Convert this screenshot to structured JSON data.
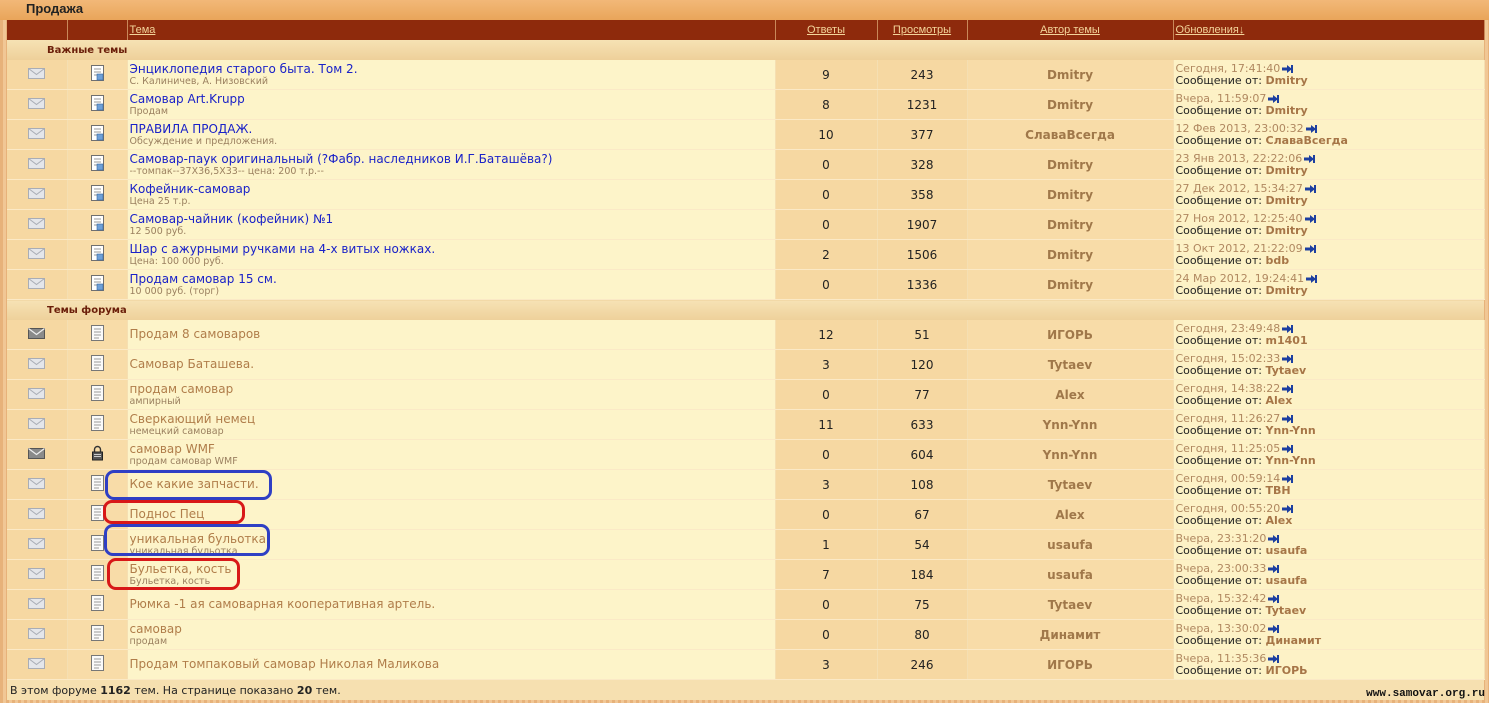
{
  "category": {
    "title": "Продажа"
  },
  "columns": {
    "topic": "Тема",
    "replies": "Ответы",
    "views": "Просмотры",
    "author": "Автор темы",
    "updates": "Обновления↓"
  },
  "sections": {
    "important": "Важные темы",
    "forum": "Темы форума"
  },
  "reply_prefix": "Сообщение от:",
  "important_topics": [
    {
      "title": "Энциклопедия старого быта. Том 2.",
      "desc": "С. Калиничев, А. Низовский",
      "replies": "9",
      "views": "243",
      "author": "Dmitry",
      "date": "Сегодня, 17:41:40",
      "by": "Dmitry"
    },
    {
      "title": "Самовар Art.Krupp",
      "desc": "Продам",
      "replies": "8",
      "views": "1231",
      "author": "Dmitry",
      "date": "Вчера, 11:59:07",
      "by": "Dmitry"
    },
    {
      "title": "ПРАВИЛА ПРОДАЖ.",
      "desc": "Обсуждение и предложения.",
      "replies": "10",
      "views": "377",
      "author": "СлаваВсегда",
      "date": "12 Фев 2013, 23:00:32",
      "by": "СлаваВсегда"
    },
    {
      "title": "Самовар-паук оригинальный (?Фабр. наследников И.Г.Баташёва?)",
      "desc": "--томпак--37X36,5X33-- цена: 200 т.р.--",
      "replies": "0",
      "views": "328",
      "author": "Dmitry",
      "date": "23 Янв 2013, 22:22:06",
      "by": "Dmitry"
    },
    {
      "title": "Кофейник-самовар",
      "desc": "Цена 25 т.р.",
      "replies": "0",
      "views": "358",
      "author": "Dmitry",
      "date": "27 Дек 2012, 15:34:27",
      "by": "Dmitry"
    },
    {
      "title": "Самовар-чайник (кофейник) №1",
      "desc": "12 500 руб.",
      "replies": "0",
      "views": "1907",
      "author": "Dmitry",
      "date": "27 Ноя 2012, 12:25:40",
      "by": "Dmitry"
    },
    {
      "title": "Шар с ажурными ручками на 4-х витых ножках.",
      "desc": "Цена: 100 000 руб.",
      "replies": "2",
      "views": "1506",
      "author": "Dmitry",
      "date": "13 Окт 2012, 21:22:09",
      "by": "bdb"
    },
    {
      "title": "Продам самовар 15 см.",
      "desc": "10 000 руб. (торг)",
      "replies": "0",
      "views": "1336",
      "author": "Dmitry",
      "date": "24 Мар 2012, 19:24:41",
      "by": "Dmitry"
    }
  ],
  "forum_topics": [
    {
      "title": "Продам 8 самоваров",
      "desc": "",
      "replies": "12",
      "views": "51",
      "author": "ИГОРЬ",
      "date": "Сегодня, 23:49:48",
      "by": "m1401",
      "icon": "envelope-new-icon",
      "doc": "topic-icon"
    },
    {
      "title": "Самовар Баташева.",
      "desc": "",
      "replies": "3",
      "views": "120",
      "author": "Tytaev",
      "date": "Сегодня, 15:02:33",
      "by": "Tytaev",
      "icon": "envelope-icon",
      "doc": "topic-icon"
    },
    {
      "title": "продам самовар",
      "desc": "ампирный",
      "replies": "0",
      "views": "77",
      "author": "Alex",
      "date": "Сегодня, 14:38:22",
      "by": "Alex",
      "icon": "envelope-icon",
      "doc": "topic-icon"
    },
    {
      "title": "Сверкающий немец",
      "desc": "немецкий самовар",
      "replies": "11",
      "views": "633",
      "author": "Ynn-Ynn",
      "date": "Сегодня, 11:26:27",
      "by": "Ynn-Ynn",
      "icon": "envelope-icon",
      "doc": "topic-icon"
    },
    {
      "title": "самовар WMF",
      "desc": "продам самовар WMF",
      "replies": "0",
      "views": "604",
      "author": "Ynn-Ynn",
      "date": "Сегодня, 11:25:05",
      "by": "Ynn-Ynn",
      "icon": "envelope-new-icon",
      "doc": "lock-icon"
    },
    {
      "title": "Кое какие запчасти.",
      "desc": "",
      "replies": "3",
      "views": "108",
      "author": "Tytaev",
      "date": "Сегодня, 00:59:14",
      "by": "ТВН",
      "icon": "envelope-icon",
      "doc": "topic-icon"
    },
    {
      "title": "Поднос Пец",
      "desc": "",
      "replies": "0",
      "views": "67",
      "author": "Alex",
      "date": "Сегодня, 00:55:20",
      "by": "Alex",
      "icon": "envelope-icon",
      "doc": "topic-icon"
    },
    {
      "title": "уникальная бульотка",
      "desc": "уникальная бульотка",
      "replies": "1",
      "views": "54",
      "author": "usaufa",
      "date": "Вчера, 23:31:20",
      "by": "usaufa",
      "icon": "envelope-icon",
      "doc": "topic-icon"
    },
    {
      "title": "Бульетка, кость",
      "desc": "Бульетка, кость",
      "replies": "7",
      "views": "184",
      "author": "usaufa",
      "date": "Вчера, 23:00:33",
      "by": "usaufa",
      "icon": "envelope-icon",
      "doc": "topic-icon"
    },
    {
      "title": "Рюмка -1 ая самоварная кооперативная артель.",
      "desc": "",
      "replies": "0",
      "views": "75",
      "author": "Tytaev",
      "date": "Вчера, 15:32:42",
      "by": "Tytaev",
      "icon": "envelope-icon",
      "doc": "topic-icon"
    },
    {
      "title": "самовар",
      "desc": "продам",
      "replies": "0",
      "views": "80",
      "author": "Динамит",
      "date": "Вчера, 13:30:02",
      "by": "Динамит",
      "icon": "envelope-icon",
      "doc": "topic-icon"
    },
    {
      "title": "Продам томпаковый самовар Николая Маликова",
      "desc": "",
      "replies": "3",
      "views": "246",
      "author": "ИГОРЬ",
      "date": "Вчера, 11:35:36",
      "by": "ИГОРЬ",
      "icon": "envelope-icon",
      "doc": "topic-icon"
    }
  ],
  "footer": {
    "prefix": "В этом форуме",
    "total": "1162",
    "mid": "тем. На странице показано",
    "shown": "20",
    "suffix": "тем."
  },
  "watermark": "www.samovar.org.ru",
  "colors": {
    "header": "#8e2a0c",
    "blue_mark": "#2f3fc4",
    "red_mark": "#d81818"
  }
}
